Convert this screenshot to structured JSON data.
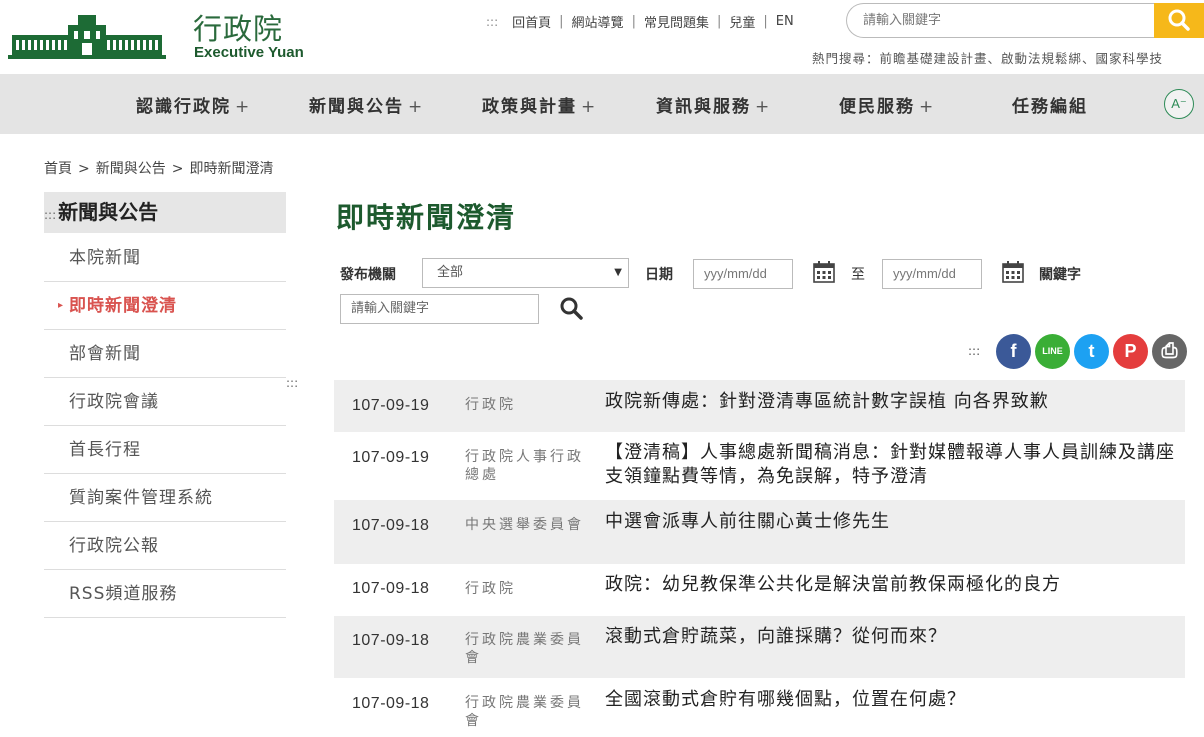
{
  "header": {
    "logo_zh": "行政院",
    "logo_en": "Executive Yuan",
    "topnav_marker": ":::",
    "topnav": [
      "回首頁",
      "網站導覽",
      "常見問題集",
      "兒童",
      "EN"
    ],
    "search_placeholder": "請輸入關鍵字",
    "hot_search": "熱門搜尋：前瞻基礎建設計畫、啟動法規鬆綁、國家科學技"
  },
  "mainnav": {
    "items": [
      {
        "label": "認識行政院",
        "plus": "+"
      },
      {
        "label": "新聞與公告",
        "plus": "+"
      },
      {
        "label": "政策與計畫",
        "plus": "+"
      },
      {
        "label": "資訊與服務",
        "plus": "+"
      },
      {
        "label": "便民服務",
        "plus": "+"
      },
      {
        "label": "任務編組",
        "plus": ""
      }
    ],
    "font_size_label": "A⁻"
  },
  "breadcrumb": [
    "首頁",
    "新聞與公告",
    "即時新聞澄清"
  ],
  "sidebar": {
    "marker": ":::",
    "title": "新聞與公告",
    "items": [
      "本院新聞",
      "即時新聞澄清",
      "部會新聞",
      "行政院會議",
      "首長行程",
      "質詢案件管理系統",
      "行政院公報",
      "RSS頻道服務"
    ],
    "active_index": 1
  },
  "content": {
    "title": "即時新聞澄清",
    "filters": {
      "agency_label": "發布機關",
      "agency_value": "全部",
      "date_label": "日期",
      "date_from_placeholder": "yyy/mm/dd",
      "to_label": "至",
      "date_to_placeholder": "yyy/mm/dd",
      "keyword_label": "關鍵字",
      "keyword_placeholder": "請輸入關鍵字"
    },
    "share_marker": ":::",
    "share": [
      {
        "icon": "facebook-icon",
        "glyph": "f",
        "color": "#3b5998"
      },
      {
        "icon": "line-icon",
        "glyph": "LINE",
        "color": "#3aae36"
      },
      {
        "icon": "twitter-icon",
        "glyph": "t",
        "color": "#1da1f2"
      },
      {
        "icon": "plurk-icon",
        "glyph": "P",
        "color": "#e43d3d"
      },
      {
        "icon": "print-icon",
        "glyph": "⎙",
        "color": "#666666"
      }
    ],
    "news": [
      {
        "date": "107-09-19",
        "org": "行政院",
        "title": "政院新傳處：針對澄清專區統計數字誤植 向各界致歉"
      },
      {
        "date": "107-09-19",
        "org": "行政院人事行政總處",
        "title": "【澄清稿】人事總處新聞稿消息：針對媒體報導人事人員訓練及講座支領鐘點費等情，為免誤解，特予澄清"
      },
      {
        "date": "107-09-18",
        "org": "中央選舉委員會",
        "title": "中選會派專人前往關心黃士修先生"
      },
      {
        "date": "107-09-18",
        "org": "行政院",
        "title": "政院：幼兒教保準公共化是解決當前教保兩極化的良方"
      },
      {
        "date": "107-09-18",
        "org": "行政院農業委員會",
        "title": "滾動式倉貯蔬菜，向誰採購？從何而來？"
      },
      {
        "date": "107-09-18",
        "org": "行政院農業委員會",
        "title": "全國滾動式倉貯有哪幾個點，位置在何處？"
      }
    ]
  },
  "colors": {
    "brand_green": "#1d5a2e",
    "accent_yellow": "#f6b81a",
    "active_red": "#d9534f"
  }
}
